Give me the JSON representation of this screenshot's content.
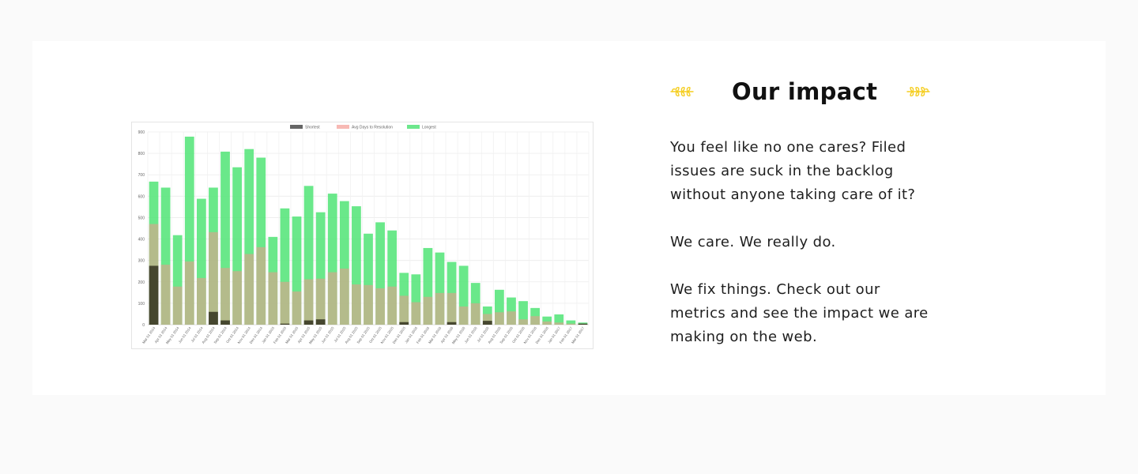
{
  "impact": {
    "title": "Our impact",
    "paragraph_1": "You feel like no one cares? Filed issues are suck in the backlog without anyone taking care of it?",
    "paragraph_2": "We care. We really do.",
    "paragraph_3": "We fix things. Check out our metrics and see the impact we are making on the web.",
    "laurel_left_icon": "laurel-left-icon",
    "laurel_right_icon": "laurel-right-icon",
    "accent_color": "#f5cd1e"
  },
  "chart_data": {
    "type": "bar",
    "title": "",
    "xlabel": "",
    "ylabel": "",
    "ylim": [
      0,
      900
    ],
    "yticks": [
      0,
      100,
      200,
      300,
      400,
      500,
      600,
      700,
      800,
      900
    ],
    "grid": true,
    "legend_position": "top",
    "categories": [
      "Mar 01 2014",
      "Apr 01 2014",
      "May 01 2014",
      "Jun 01 2014",
      "Jul 01 2014",
      "Aug 01 2014",
      "Sep 01 2014",
      "Oct 01 2014",
      "Nov 01 2014",
      "Dec 01 2014",
      "Jan 01 2015",
      "Feb 01 2015",
      "Mar 01 2015",
      "Apr 01 2015",
      "May 01 2015",
      "Jun 01 2015",
      "Jul 01 2015",
      "Aug 01 2015",
      "Sep 01 2015",
      "Oct 01 2015",
      "Nov 01 2015",
      "Dec 01 2015",
      "Jan 01 2016",
      "Feb 01 2016",
      "Mar 01 2016",
      "Apr 01 2016",
      "May 01 2016",
      "Jun 01 2016",
      "Jul 01 2016",
      "Aug 01 2016",
      "Sep 01 2016",
      "Oct 01 2016",
      "Nov 01 2016",
      "Dec 01 2016",
      "Jan 01 2017",
      "Feb 01 2017",
      "Mar 01 2017"
    ],
    "xtick_labels": [
      "Mar 01 2014",
      "Apr 01 2014",
      "May 01 2014",
      "Jun 01 2014",
      "Jul 01 2014",
      "Aug 01 2014",
      "Sep 01 2014",
      "Oct 01 2014",
      "Nov 01 2014",
      "Dec 01 2014",
      "Jan 01 2015",
      "Feb 01 2015",
      "Mar 01 2015",
      "Apr 01 2015",
      "May 01 2015",
      "Jun 01 2015",
      "Jul 01 2015",
      "Aug 01 2015",
      "Sep 01 2015",
      "Oct 01 2015",
      "Nov 01 2015",
      "Dec 01 2015",
      "Jan 01 2016",
      "Feb 01 2016",
      "Mar 01 2016",
      "Apr 01 2016",
      "May 01 2016",
      "Jun 01 2016",
      "Jul 01 2016",
      "Aug 01 2016",
      "Sep 01 2016",
      "Oct 01 2016",
      "Nov 01 2016",
      "Dec 01 2016",
      "Jan 01 2017",
      "Feb 01 2017",
      "Mar 01 2017"
    ],
    "series": [
      {
        "name": "Shortest",
        "color": "#555555",
        "values": [
          275,
          0,
          0,
          0,
          0,
          60,
          20,
          0,
          0,
          0,
          0,
          5,
          0,
          20,
          25,
          0,
          0,
          0,
          0,
          0,
          0,
          12,
          0,
          0,
          0,
          12,
          0,
          0,
          18,
          0,
          0,
          0,
          0,
          0,
          0,
          0,
          5
        ]
      },
      {
        "name": "Avg Days to Resolution",
        "color": "#f9b9b5",
        "values": [
          470,
          280,
          178,
          295,
          218,
          432,
          265,
          250,
          330,
          362,
          245,
          200,
          155,
          212,
          215,
          245,
          262,
          188,
          185,
          170,
          178,
          135,
          105,
          130,
          148,
          148,
          85,
          100,
          50,
          58,
          62,
          25,
          40,
          15,
          10,
          5,
          5
        ]
      },
      {
        "name": "Longest",
        "color": "#6dea8d",
        "values": [
          668,
          640,
          418,
          878,
          588,
          640,
          808,
          735,
          820,
          780,
          410,
          543,
          505,
          648,
          525,
          612,
          577,
          553,
          425,
          478,
          440,
          242,
          235,
          358,
          337,
          293,
          275,
          195,
          85,
          163,
          127,
          110,
          78,
          38,
          48,
          20,
          10
        ]
      }
    ]
  }
}
